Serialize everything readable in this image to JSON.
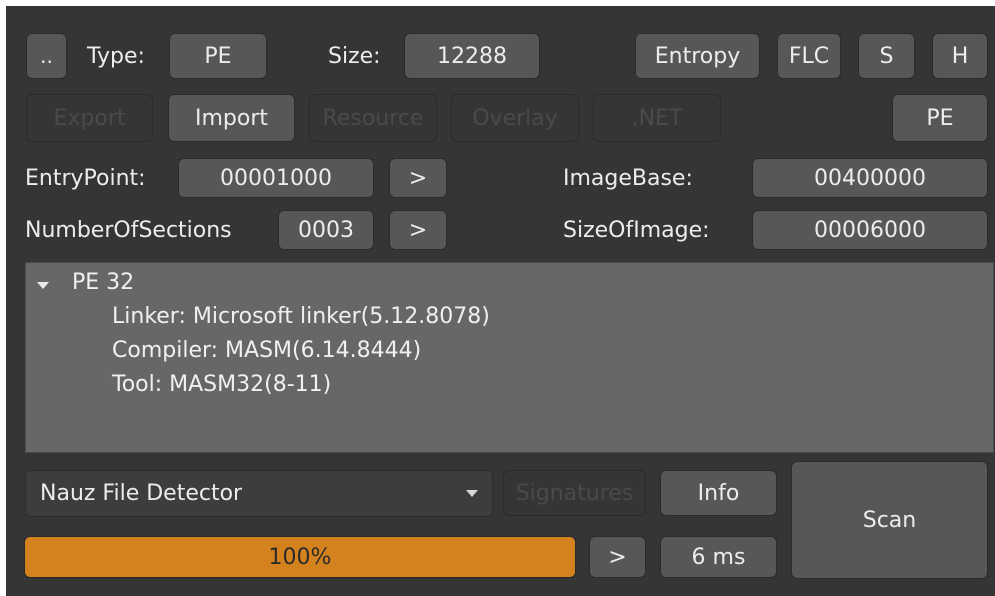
{
  "toolbar": {
    "dotdot_label": "..",
    "type_label": "Type:",
    "type_value": "PE",
    "size_label": "Size:",
    "size_value": "12288",
    "entropy_label": "Entropy",
    "flc_label": "FLC",
    "s_label": "S",
    "h_label": "H"
  },
  "tabs_row": {
    "export_label": "Export",
    "import_label": "Import",
    "resource_label": "Resource",
    "overlay_label": "Overlay",
    "net_label": ".NET",
    "pe_label": "PE"
  },
  "header_fields": {
    "entry_point_label": "EntryPoint:",
    "entry_point_value": "00001000",
    "entry_point_go": ">",
    "image_base_label": "ImageBase:",
    "image_base_value": "00400000",
    "sections_label": "NumberOfSections",
    "sections_value": "0003",
    "sections_go": ">",
    "size_of_image_label": "SizeOfImage:",
    "size_of_image_value": "00006000"
  },
  "results": {
    "root_label": "PE 32",
    "items": [
      "Linker: Microsoft linker(5.12.8078)",
      "Compiler: MASM(6.14.8444)",
      "Tool: MASM32(8-11)"
    ]
  },
  "bottom": {
    "detector_selected": "Nauz File Detector",
    "signatures_label": "Signatures",
    "info_label": "Info",
    "scan_label": "Scan",
    "progress_percent": 100,
    "progress_text": "100%",
    "go_label": ">",
    "time_text": "6 ms"
  },
  "colors": {
    "window_bg": "#353535",
    "button_bg": "#575757",
    "tree_bg": "#676767",
    "progress_fill": "#d4821e"
  }
}
